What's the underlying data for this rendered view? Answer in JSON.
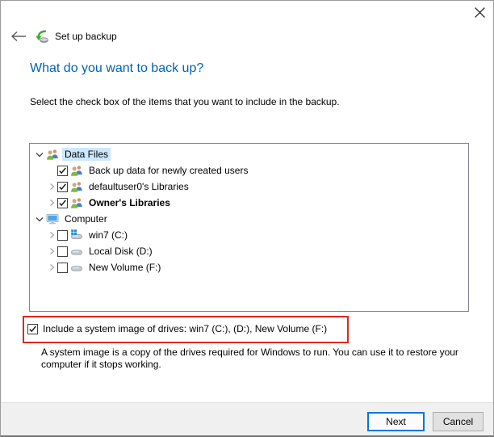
{
  "nav": {
    "back_icon": "arrow-left",
    "app_icon": "backup-disk-green-arrow",
    "title": "Set up backup",
    "close_icon": "x"
  },
  "heading": "What do you want to back up?",
  "subheading": "Select the check box of the items that you want to include in the backup.",
  "tree": {
    "items": [
      {
        "label": "Data Files",
        "level": 0,
        "expander": "expanded",
        "checkbox": null,
        "icon": "users",
        "selected": true,
        "bold": false
      },
      {
        "label": "Back up data for newly created users",
        "level": 1,
        "expander": "none",
        "checkbox": "checked",
        "icon": "users",
        "selected": false,
        "bold": false
      },
      {
        "label": "defaultuser0's Libraries",
        "level": 1,
        "expander": "collapsed",
        "checkbox": "checked",
        "icon": "users",
        "selected": false,
        "bold": false
      },
      {
        "label": "Owner's Libraries",
        "level": 1,
        "expander": "collapsed",
        "checkbox": "checked",
        "icon": "users",
        "selected": false,
        "bold": true
      },
      {
        "label": "Computer",
        "level": 0,
        "expander": "expanded",
        "checkbox": null,
        "icon": "computer",
        "selected": false,
        "bold": false
      },
      {
        "label": "win7 (C:)",
        "level": 1,
        "expander": "collapsed",
        "checkbox": "unchecked",
        "icon": "disk-windows",
        "selected": false,
        "bold": false
      },
      {
        "label": "Local Disk (D:)",
        "level": 1,
        "expander": "collapsed",
        "checkbox": "unchecked",
        "icon": "disk",
        "selected": false,
        "bold": false
      },
      {
        "label": "New Volume (F:)",
        "level": 1,
        "expander": "collapsed",
        "checkbox": "unchecked",
        "icon": "disk",
        "selected": false,
        "bold": false
      }
    ]
  },
  "system_image": {
    "checked": true,
    "label": "Include a system image of drives: win7 (C:), (D:), New Volume (F:)",
    "description": "A system image is a copy of the drives required for Windows to run. You can use it to restore your computer if it stops working.",
    "annotation": "red-highlight-box"
  },
  "buttons": {
    "next": "Next",
    "cancel": "Cancel"
  },
  "colors": {
    "heading_blue": "#0063b1",
    "selection_blue": "#cce8ff",
    "accent_blue": "#0078d7",
    "annotation_red": "#dd281e",
    "footer_gray": "#f0f0f0"
  }
}
